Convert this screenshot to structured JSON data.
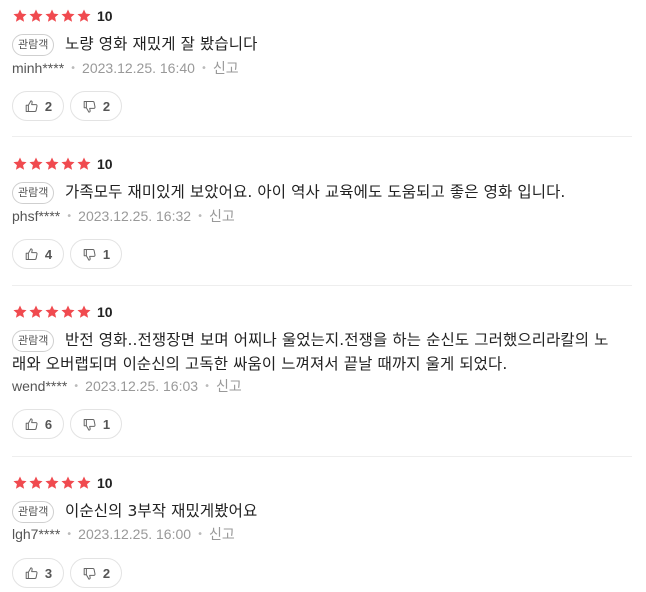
{
  "reviews": [
    {
      "stars": 5,
      "score": "10",
      "badge": "관람객",
      "content": "노량 영화 재밌게 잘 봤습니다",
      "author": "minh****",
      "date": "2023.12.25. 16:40",
      "report_label": "신고",
      "likes": "2",
      "dislikes": "2"
    },
    {
      "stars": 5,
      "score": "10",
      "badge": "관람객",
      "content": "가족모두 재미있게 보았어요. 아이 역사 교육에도 도움되고 좋은 영화 입니다.",
      "author": "phsf****",
      "date": "2023.12.25. 16:32",
      "report_label": "신고",
      "likes": "4",
      "dislikes": "1"
    },
    {
      "stars": 5,
      "score": "10",
      "badge": "관람객",
      "content": "반전 영화..전쟁장면 보며 어찌나 울었는지.전쟁을 하는 순신도 그러했으리라칼의 노래와 오버랩되며 이순신의 고독한 싸움이 느껴져서 끝날 때까지 울게 되었다.",
      "author": "wend****",
      "date": "2023.12.25. 16:03",
      "report_label": "신고",
      "likes": "6",
      "dislikes": "1"
    },
    {
      "stars": 5,
      "score": "10",
      "badge": "관람객",
      "content": "이순신의 3부작 재밌게봤어요",
      "author": "lgh7****",
      "date": "2023.12.25. 16:00",
      "report_label": "신고",
      "likes": "3",
      "dislikes": "2"
    }
  ],
  "colors": {
    "star": "#f04a4f",
    "text": "#222222",
    "meta": "#999999",
    "border": "#e3e3e3"
  },
  "icons": {
    "star": "star-icon",
    "like": "thumbs-up-icon",
    "dislike": "thumbs-down-icon"
  }
}
